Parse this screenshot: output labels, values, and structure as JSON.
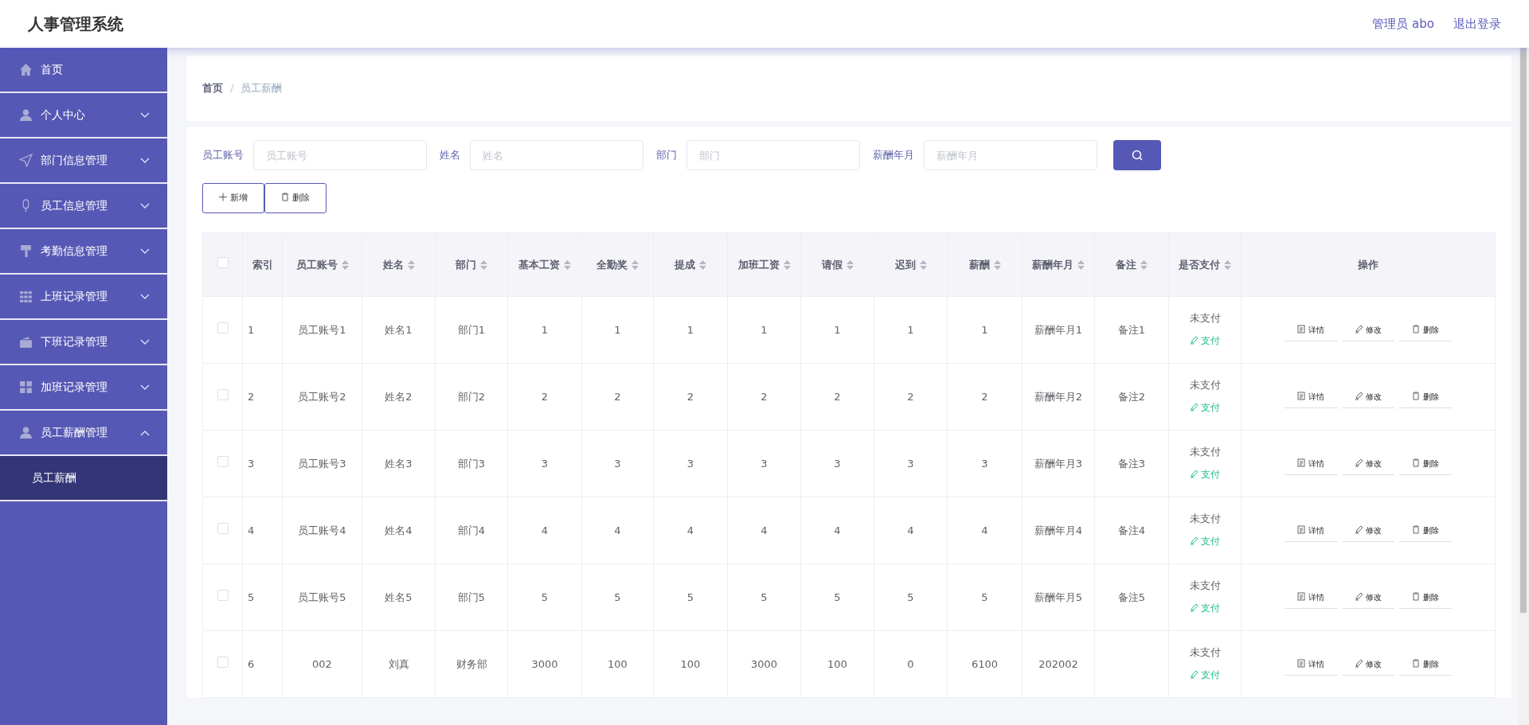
{
  "header": {
    "title": "人事管理系统",
    "user": "管理员 abo",
    "logout": "退出登录"
  },
  "sidebar": {
    "items": [
      {
        "label": "首页",
        "kind": "link"
      },
      {
        "label": "个人中心",
        "kind": "menu",
        "expanded": false
      },
      {
        "label": "部门信息管理",
        "kind": "menu",
        "expanded": false
      },
      {
        "label": "员工信息管理",
        "kind": "menu",
        "expanded": false
      },
      {
        "label": "考勤信息管理",
        "kind": "menu",
        "expanded": false
      },
      {
        "label": "上班记录管理",
        "kind": "menu",
        "expanded": false
      },
      {
        "label": "下班记录管理",
        "kind": "menu",
        "expanded": false
      },
      {
        "label": "加班记录管理",
        "kind": "menu",
        "expanded": false
      },
      {
        "label": "员工薪酬管理",
        "kind": "menu",
        "expanded": true,
        "children": [
          {
            "label": "员工薪酬",
            "selected": true
          }
        ]
      }
    ]
  },
  "breadcrumb": {
    "separator": "/",
    "items": [
      "首页",
      "员工薪酬"
    ]
  },
  "filters": [
    {
      "label": "员工账号",
      "placeholder": "员工账号"
    },
    {
      "label": "姓名",
      "placeholder": "姓名"
    },
    {
      "label": "部门",
      "placeholder": "部门"
    },
    {
      "label": "薪酬年月",
      "placeholder": "薪酬年月"
    }
  ],
  "toolbar": {
    "add": "新增",
    "delete": "删除"
  },
  "table": {
    "select_all_checked": false,
    "columns": [
      {
        "label": "索引",
        "sortable": false
      },
      {
        "label": "员工账号",
        "sortable": true
      },
      {
        "label": "姓名",
        "sortable": true
      },
      {
        "label": "部门",
        "sortable": true
      },
      {
        "label": "基本工资",
        "sortable": true
      },
      {
        "label": "全勤奖",
        "sortable": true
      },
      {
        "label": "提成",
        "sortable": true
      },
      {
        "label": "加班工资",
        "sortable": true
      },
      {
        "label": "请假",
        "sortable": true
      },
      {
        "label": "迟到",
        "sortable": true
      },
      {
        "label": "薪酬",
        "sortable": true
      },
      {
        "label": "薪酬年月",
        "sortable": true
      },
      {
        "label": "备注",
        "sortable": true
      },
      {
        "label": "是否支付",
        "sortable": true
      },
      {
        "label": "操作",
        "sortable": false
      }
    ],
    "rows": [
      {
        "checked": false,
        "cells": [
          "1",
          "员工账号1",
          "姓名1",
          "部门1",
          "1",
          "1",
          "1",
          "1",
          "1",
          "1",
          "1",
          "薪酬年月1",
          "备注1"
        ],
        "pay_status": "未支付",
        "pay_action": "支付",
        "actions": [
          "详情",
          "修改",
          "删除"
        ]
      },
      {
        "checked": false,
        "cells": [
          "2",
          "员工账号2",
          "姓名2",
          "部门2",
          "2",
          "2",
          "2",
          "2",
          "2",
          "2",
          "2",
          "薪酬年月2",
          "备注2"
        ],
        "pay_status": "未支付",
        "pay_action": "支付",
        "actions": [
          "详情",
          "修改",
          "删除"
        ]
      },
      {
        "checked": false,
        "cells": [
          "3",
          "员工账号3",
          "姓名3",
          "部门3",
          "3",
          "3",
          "3",
          "3",
          "3",
          "3",
          "3",
          "薪酬年月3",
          "备注3"
        ],
        "pay_status": "未支付",
        "pay_action": "支付",
        "actions": [
          "详情",
          "修改",
          "删除"
        ]
      },
      {
        "checked": false,
        "cells": [
          "4",
          "员工账号4",
          "姓名4",
          "部门4",
          "4",
          "4",
          "4",
          "4",
          "4",
          "4",
          "4",
          "薪酬年月4",
          "备注4"
        ],
        "pay_status": "未支付",
        "pay_action": "支付",
        "actions": [
          "详情",
          "修改",
          "删除"
        ]
      },
      {
        "checked": false,
        "cells": [
          "5",
          "员工账号5",
          "姓名5",
          "部门5",
          "5",
          "5",
          "5",
          "5",
          "5",
          "5",
          "5",
          "薪酬年月5",
          "备注5"
        ],
        "pay_status": "未支付",
        "pay_action": "支付",
        "actions": [
          "详情",
          "修改",
          "删除"
        ]
      },
      {
        "checked": false,
        "cells": [
          "6",
          "002",
          "刘真",
          "财务部",
          "3000",
          "100",
          "100",
          "3000",
          "100",
          "0",
          "6100",
          "202002",
          ""
        ],
        "pay_status": "未支付",
        "pay_action": "支付",
        "actions": [
          "详情",
          "修改",
          "删除"
        ]
      }
    ]
  }
}
